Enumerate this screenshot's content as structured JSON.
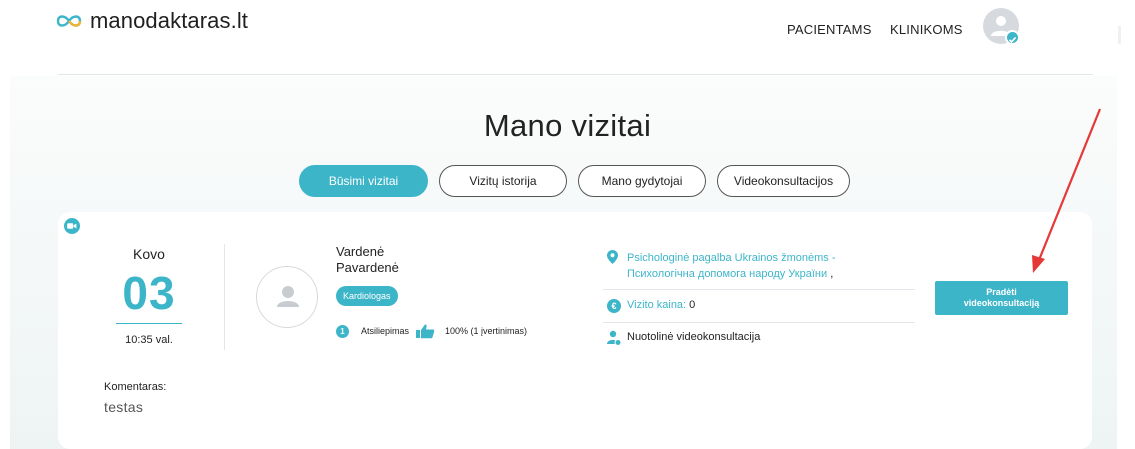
{
  "header": {
    "logo_text": "manodaktaras.lt",
    "nav": [
      {
        "label": "PACIENTAMS"
      },
      {
        "label": "KLINIKOMS"
      }
    ]
  },
  "page": {
    "title": "Mano vizitai"
  },
  "tabs": [
    {
      "label": "Būsimi vizitai",
      "active": true
    },
    {
      "label": "Vizitų istorija",
      "active": false
    },
    {
      "label": "Mano gydytojai",
      "active": false
    },
    {
      "label": "Videokonsultacijos",
      "active": false
    }
  ],
  "visit": {
    "month": "Kovo",
    "day": "03",
    "time": "10:35 val.",
    "doctor_name_line1": "Vardenė",
    "doctor_name_line2": "Pavardenė",
    "specialty": "Kardiologas",
    "rating_count": "1",
    "rating_label": "Atsiliepimas",
    "rating_value": "100% (1 įvertinimas)",
    "location_line1": "Psichologinė pagalba Ukrainos žmonėms -",
    "location_line2": "Психологічна допомога народу України",
    "location_suffix": ",",
    "price_label": "Vizito kaina:",
    "price_value": "0",
    "consult_type": "Nuotolinė videokonsultacija",
    "start_button": "Pradėti videokonsultaciją",
    "comment_label": "Komentaras:",
    "comment_text": "testas"
  },
  "colors": {
    "accent": "#3db5c9",
    "arrow": "#e53935"
  }
}
